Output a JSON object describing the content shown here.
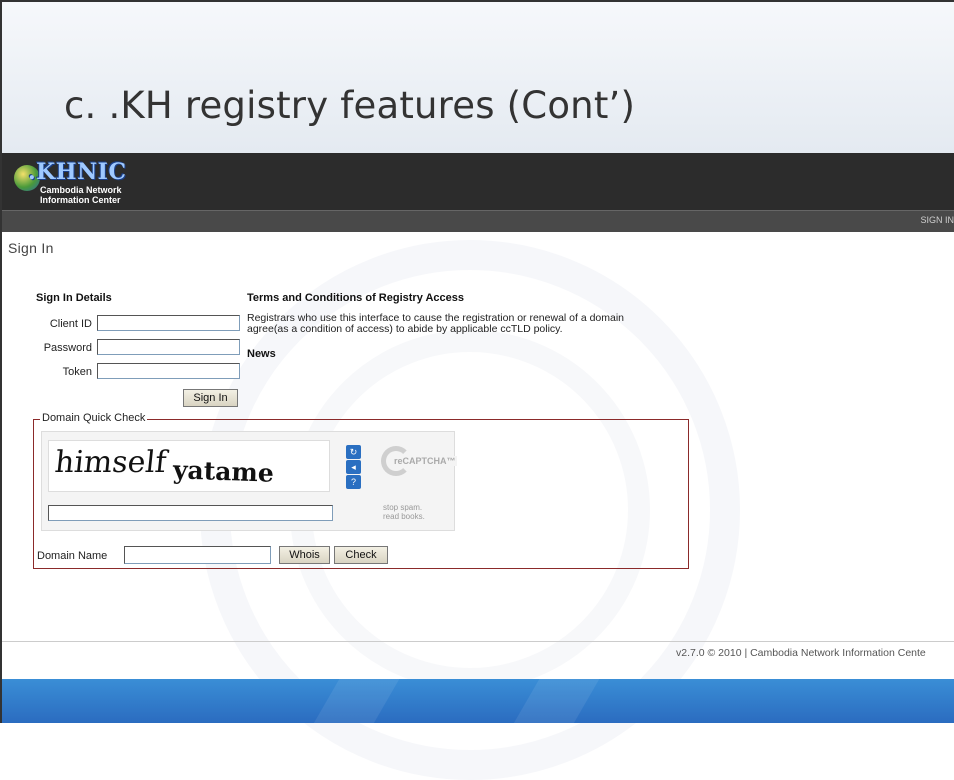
{
  "slide": {
    "title": "c. .KH registry features (Cont’)"
  },
  "header": {
    "logo_name": ".KHNIC",
    "logo_sub1": "Cambodia Network",
    "logo_sub2": "Information Center",
    "nav_signin": "SIGN IN"
  },
  "page": {
    "heading": "Sign In"
  },
  "signin": {
    "section_title": "Sign In Details",
    "client_id_label": "Client ID",
    "client_id_value": "",
    "password_label": "Password",
    "password_value": "",
    "token_label": "Token",
    "token_value": "",
    "button_label": "Sign In"
  },
  "terms": {
    "title": "Terms and Conditions of Registry Access",
    "line1": "Registrars who use this interface to cause the registration or renewal of a domain",
    "line2": "agree(as a condition of access) to abide by applicable ccTLD policy.",
    "news_title": "News"
  },
  "quick_check": {
    "legend": "Domain Quick Check",
    "captcha_word1": "himself",
    "captcha_word2": "yatame",
    "captcha_answer": "",
    "recaptcha_word": "reCAPTCHA™",
    "tagline1": "stop spam.",
    "tagline2": "read books.",
    "domain_label": "Domain Name",
    "domain_value": "",
    "whois_label": "Whois",
    "check_label": "Check",
    "icons": [
      "refresh-icon",
      "audio-icon",
      "help-icon"
    ]
  },
  "footer": {
    "text": "v2.7.0 © 2010 | Cambodia Network Information Cente"
  },
  "colors": {
    "header_bg": "#2c2c2c",
    "nav_bg": "#494949",
    "fieldset_border": "#8b2a2a",
    "bottom_band": "#2b6cc0"
  }
}
